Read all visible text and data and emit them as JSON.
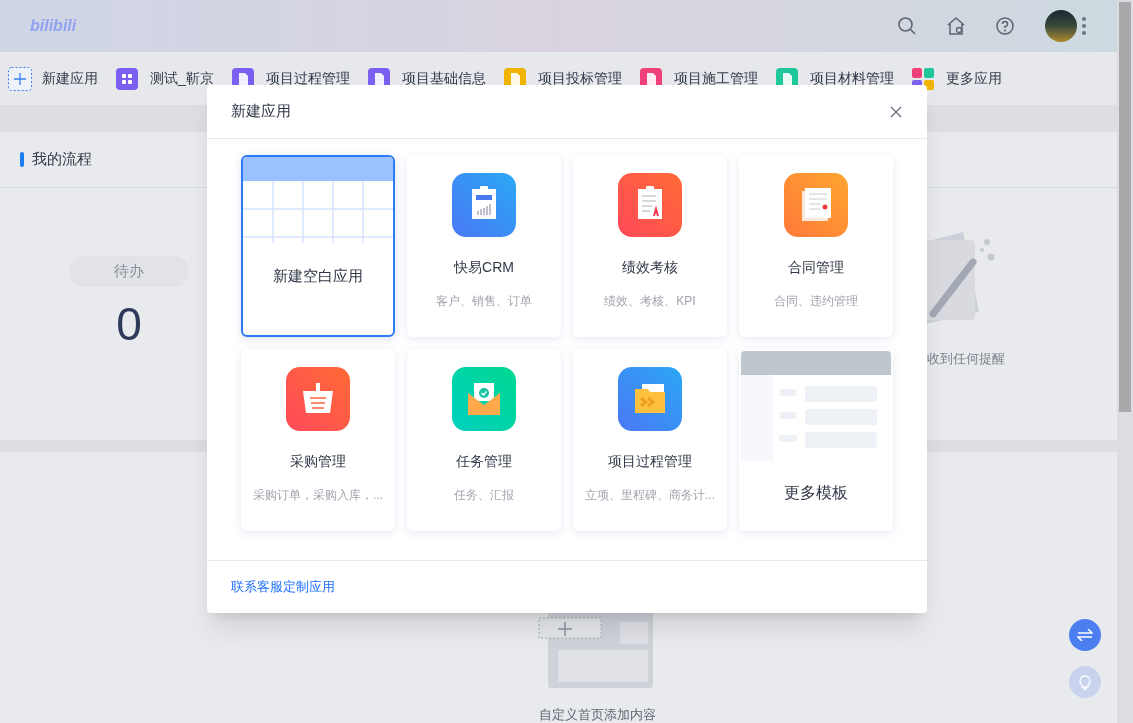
{
  "header": {
    "logo": "bilibili"
  },
  "app_bar": {
    "new_app": "新建应用",
    "apps": [
      {
        "label": "测试_靳京",
        "color": "#7b5ff0"
      },
      {
        "label": "项目过程管理",
        "color": "#7b5ff0"
      },
      {
        "label": "项目基础信息",
        "color": "#7b5ff0"
      },
      {
        "label": "项目投标管理",
        "color": "#f0b400"
      },
      {
        "label": "项目施工管理",
        "color": "#f0407a"
      },
      {
        "label": "项目材料管理",
        "color": "#1fc79a"
      }
    ],
    "more": "更多应用"
  },
  "process_panel": {
    "title": "我的流程",
    "pill_label": "待办",
    "count": "0",
    "empty_text": "收到任何提醒"
  },
  "custom_panel": {
    "text": "自定义首页添加内容"
  },
  "dialog": {
    "title": "新建应用",
    "templates": [
      {
        "kind": "blank",
        "title": "新建空白应用",
        "selected": true
      },
      {
        "kind": "app",
        "title": "快易CRM",
        "subtitle": "客户、销售、订单",
        "selected": false
      },
      {
        "kind": "app",
        "title": "绩效考核",
        "subtitle": "绩效、考核、KPI",
        "selected": false
      },
      {
        "kind": "app",
        "title": "合同管理",
        "subtitle": "合同、违约管理",
        "selected": false
      },
      {
        "kind": "app",
        "title": "采购管理",
        "subtitle": "采购订单，采购入库，...",
        "selected": false
      },
      {
        "kind": "app",
        "title": "任务管理",
        "subtitle": "任务、汇报",
        "selected": false
      },
      {
        "kind": "app",
        "title": "项目过程管理",
        "subtitle": "立项、里程碑、商务计...",
        "selected": false
      },
      {
        "kind": "more",
        "title": "更多模板",
        "selected": false
      }
    ],
    "footer_link": "联系客服定制应用"
  }
}
